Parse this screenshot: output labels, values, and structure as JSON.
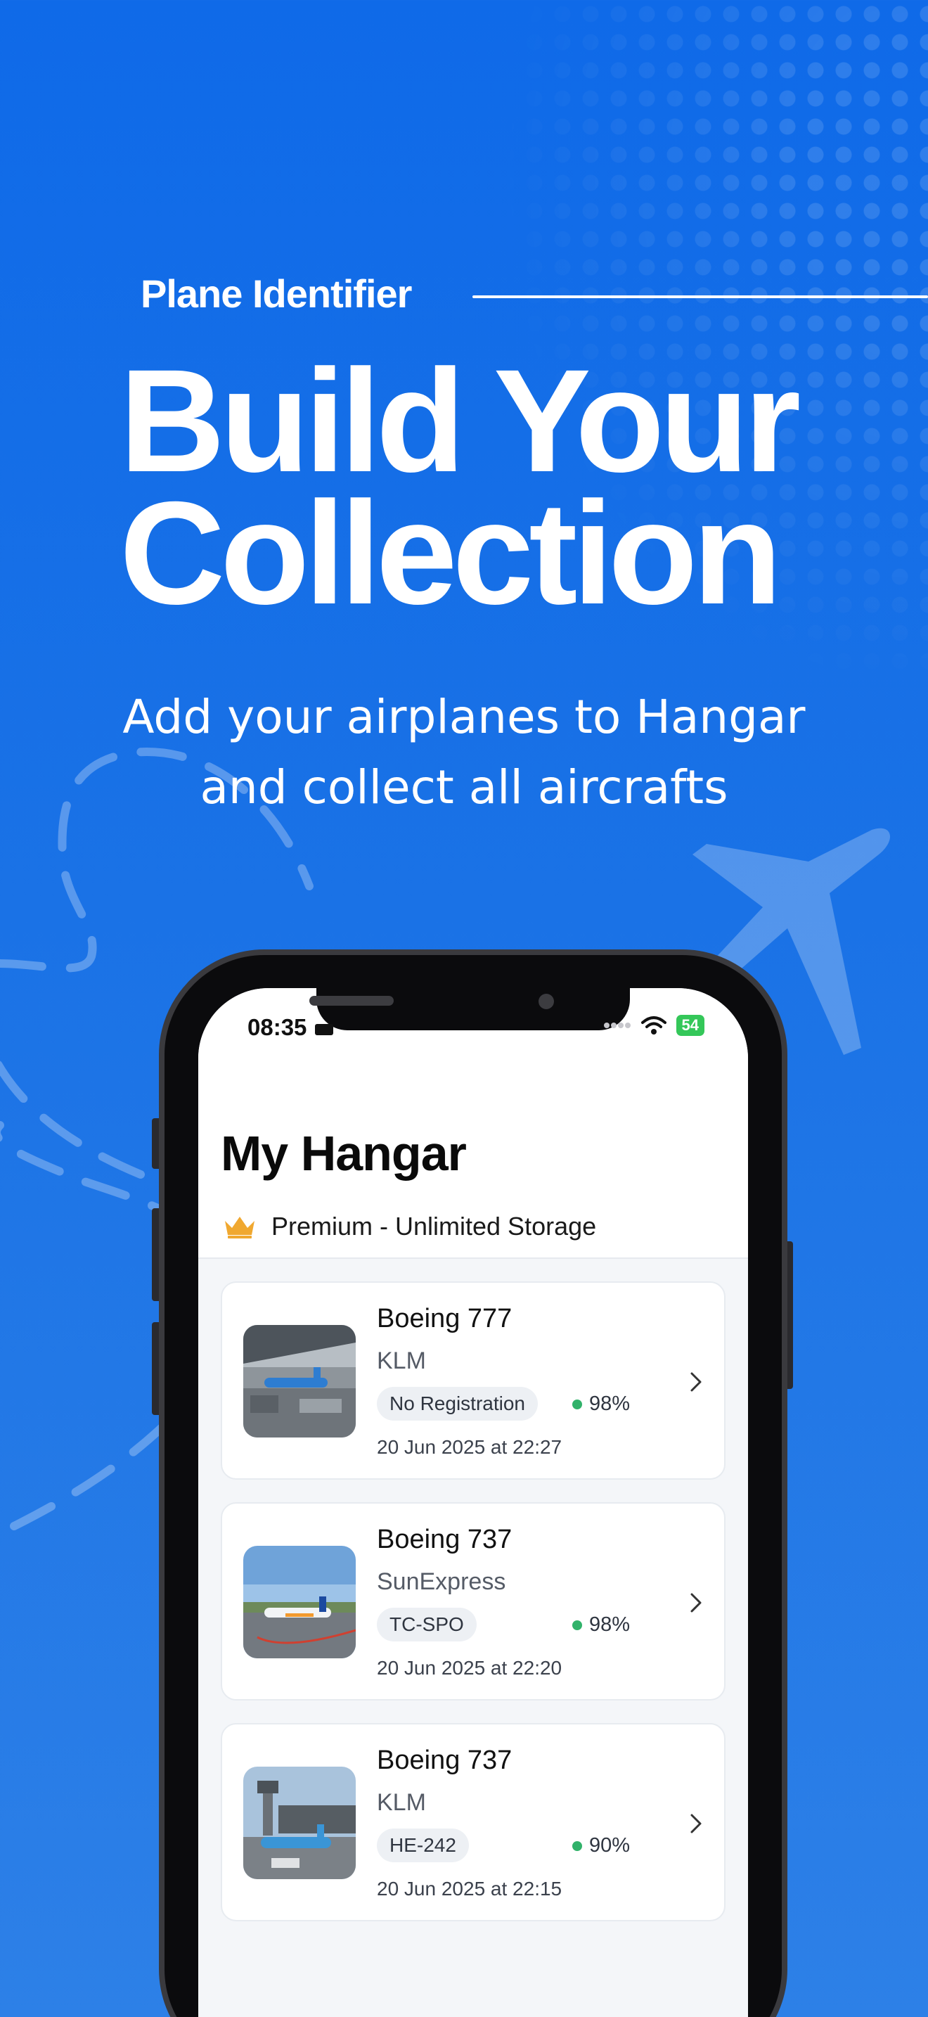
{
  "colors": {
    "background": "#1a72e6",
    "accent_green": "#31b26a",
    "crown": "#f0a830"
  },
  "hero": {
    "brand": "Plane Identifier",
    "headline_line1": "Build Your",
    "headline_line2": "Collection",
    "subtitle_line1": "Add your airplanes to Hangar",
    "subtitle_line2": "and collect all aircrafts"
  },
  "status_bar": {
    "time": "08:35",
    "battery": "54"
  },
  "hangar": {
    "title": "My Hangar",
    "premium_label": "Premium - Unlimited Storage",
    "items": [
      {
        "model": "Boeing 777",
        "airline": "KLM",
        "registration": "No Registration",
        "confidence": "98%",
        "confidence_value": 0.98,
        "date": "20 Jun 2025 at 22:27"
      },
      {
        "model": "Boeing 737",
        "airline": "SunExpress",
        "registration": "TC-SPO",
        "confidence": "98%",
        "confidence_value": 0.98,
        "date": "20 Jun 2025 at 22:20"
      },
      {
        "model": "Boeing 737",
        "airline": "KLM",
        "registration": "HE-242",
        "confidence": "90%",
        "confidence_value": 0.9,
        "date": "20 Jun 2025 at 22:15"
      }
    ]
  }
}
